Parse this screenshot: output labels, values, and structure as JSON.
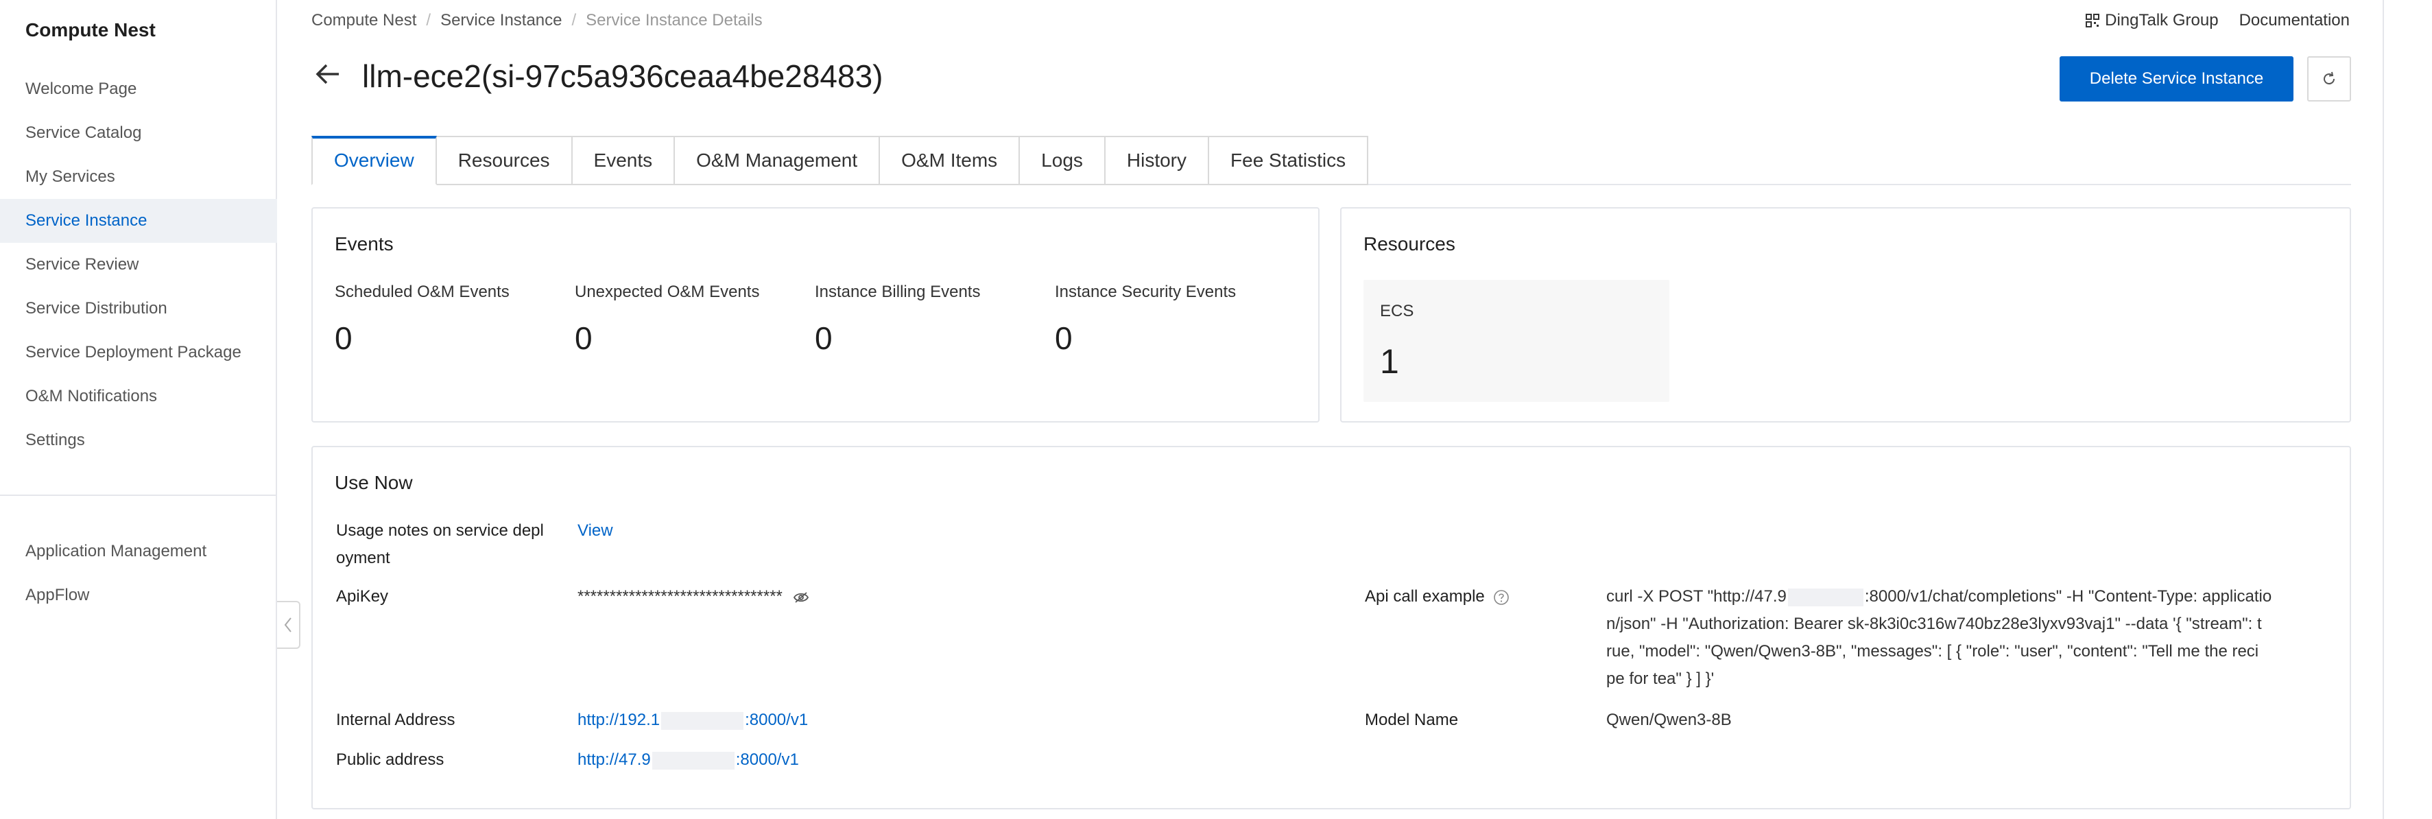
{
  "sidebar": {
    "title": "Compute Nest",
    "items": [
      {
        "label": "Welcome Page"
      },
      {
        "label": "Service Catalog"
      },
      {
        "label": "My Services"
      },
      {
        "label": "Service Instance"
      },
      {
        "label": "Service Review"
      },
      {
        "label": "Service Distribution"
      },
      {
        "label": "Service Deployment Package"
      },
      {
        "label": "O&M Notifications"
      },
      {
        "label": "Settings"
      }
    ],
    "active_item": "Service Instance",
    "secondary_items": [
      {
        "label": "Application Management"
      },
      {
        "label": "AppFlow"
      }
    ]
  },
  "breadcrumb": {
    "items": [
      "Compute Nest",
      "Service Instance",
      "Service Instance Details"
    ],
    "separator": "/"
  },
  "top_links": {
    "dingtalk": "DingTalk Group",
    "documentation": "Documentation"
  },
  "header": {
    "title": "llm-ece2(si-97c5a936ceaa4be28483)",
    "delete_button": "Delete Service Instance"
  },
  "tabs": [
    {
      "label": "Overview",
      "active": true
    },
    {
      "label": "Resources"
    },
    {
      "label": "Events"
    },
    {
      "label": "O&M Management"
    },
    {
      "label": "O&M Items"
    },
    {
      "label": "Logs"
    },
    {
      "label": "History"
    },
    {
      "label": "Fee Statistics"
    }
  ],
  "events": {
    "title": "Events",
    "stats": [
      {
        "label": "Scheduled O&M Events",
        "value": "0"
      },
      {
        "label": "Unexpected O&M Events",
        "value": "0"
      },
      {
        "label": "Instance Billing Events",
        "value": "0"
      },
      {
        "label": "Instance Security Events",
        "value": "0"
      }
    ]
  },
  "resources": {
    "title": "Resources",
    "ecs_label": "ECS",
    "ecs_value": "1"
  },
  "use_now": {
    "title": "Use Now",
    "usage_notes_label_1": "Usage notes on service depl",
    "usage_notes_label_2": "oyment",
    "usage_notes_link": "View",
    "apikey_label": "ApiKey",
    "apikey_value": "********************************",
    "internal_label": "Internal Address",
    "internal_prefix": "http://192.1",
    "internal_suffix": ":8000/v1",
    "public_label": "Public address",
    "public_prefix": "http://47.9",
    "public_suffix": ":8000/v1",
    "api_example_label": "Api call example",
    "api_example_line1_pre": "curl -X POST \"http://47.9",
    "api_example_line1_post": ":8000/v1/chat/completions\" -H \"Content-Type: applicatio",
    "api_example_line2": "n/json\" -H \"Authorization: Bearer sk-8k3i0c316w740bz28e3lyxv93vaj1\" --data '{ \"stream\": t",
    "api_example_line3": "rue, \"model\": \"Qwen/Qwen3-8B\",  \"messages\": [ { \"role\": \"user\", \"content\": \"Tell me the reci",
    "api_example_line4": "pe for tea\" } ] }'",
    "model_name_label": "Model Name",
    "model_name_value": "Qwen/Qwen3-8B"
  },
  "colors": {
    "accent": "#0064c8",
    "active_nav_bg": "#eef1f5",
    "border": "#e3e5ea"
  },
  "icons": [
    "back-arrow-icon",
    "refresh-icon",
    "qr-code-icon",
    "eye-icon",
    "help-icon",
    "chevron-left-icon"
  ]
}
